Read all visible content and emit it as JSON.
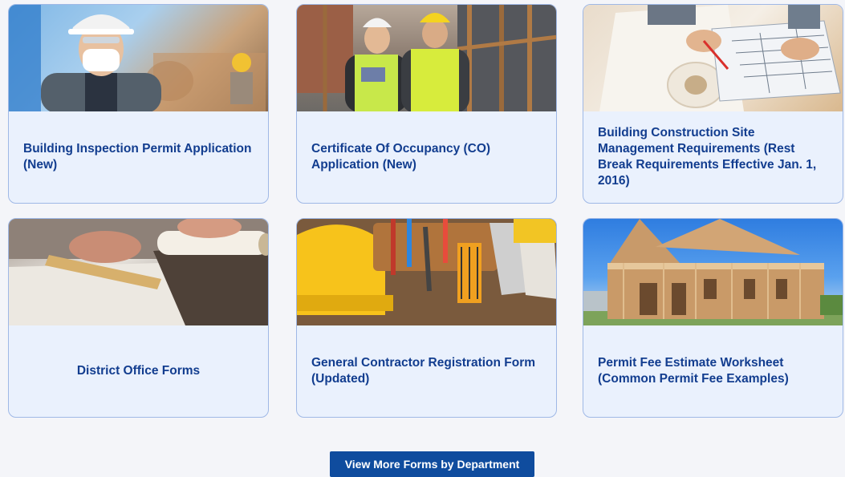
{
  "cards": [
    {
      "label": "Building Inspection Permit Application (New)"
    },
    {
      "label": "Certificate Of Occupancy (CO) Application (New)"
    },
    {
      "label": "Building Construction Site Management Requirements (Rest Break Requirements Effective Jan. 1, 2016)"
    },
    {
      "label": "District Office Forms"
    },
    {
      "label": "General Contractor Registration Form (Updated)"
    },
    {
      "label": "Permit Fee Estimate Worksheet (Common Permit Fee Examples)"
    }
  ],
  "view_more_button": "View More Forms by Department"
}
